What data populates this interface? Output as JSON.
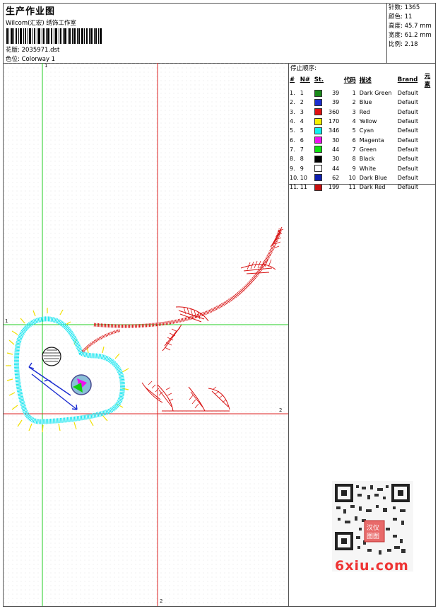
{
  "header": {
    "title": "生产作业图",
    "company": "Wilcom(汇宏) 绣饰工作室",
    "file_label": "花版",
    "file_value": "2035971.dst",
    "colorway_label": "色位",
    "colorway_value": "Colorway 1"
  },
  "stats": [
    {
      "label": "针数",
      "value": "1365"
    },
    {
      "label": "颜色",
      "value": "11"
    },
    {
      "label": "高度",
      "value": "45.7 mm"
    },
    {
      "label": "宽度",
      "value": "61.2 mm"
    },
    {
      "label": "比例",
      "value": "2.18"
    }
  ],
  "stop_sequence": {
    "title": "停止顺序:",
    "columns": [
      "#",
      "N#",
      "St.",
      "代码",
      "描述",
      "Brand",
      "元素"
    ],
    "rows": [
      {
        "n": "1.",
        "nn": "1",
        "color": "#1a8a1a",
        "st": "39",
        "code": "1",
        "desc": "Dark Green",
        "brand": "Default"
      },
      {
        "n": "2.",
        "nn": "2",
        "color": "#1c2fd0",
        "st": "39",
        "code": "2",
        "desc": "Blue",
        "brand": "Default"
      },
      {
        "n": "3.",
        "nn": "3",
        "color": "#e01010",
        "st": "360",
        "code": "3",
        "desc": "Red",
        "brand": "Default"
      },
      {
        "n": "4.",
        "nn": "4",
        "color": "#f4f000",
        "st": "170",
        "code": "4",
        "desc": "Yellow",
        "brand": "Default"
      },
      {
        "n": "5.",
        "nn": "5",
        "color": "#10f0f0",
        "st": "346",
        "code": "5",
        "desc": "Cyan",
        "brand": "Default"
      },
      {
        "n": "6.",
        "nn": "6",
        "color": "#f010f0",
        "st": "30",
        "code": "6",
        "desc": "Magenta",
        "brand": "Default"
      },
      {
        "n": "7.",
        "nn": "7",
        "color": "#10e010",
        "st": "44",
        "code": "7",
        "desc": "Green",
        "brand": "Default"
      },
      {
        "n": "8.",
        "nn": "8",
        "color": "#000000",
        "st": "30",
        "code": "8",
        "desc": "Black",
        "brand": "Default"
      },
      {
        "n": "9.",
        "nn": "9",
        "color": "#ffffff",
        "st": "44",
        "code": "9",
        "desc": "White",
        "brand": "Default"
      },
      {
        "n": "10.",
        "nn": "10",
        "color": "#1020b0",
        "st": "62",
        "code": "10",
        "desc": "Dark Blue",
        "brand": "Default"
      },
      {
        "n": "11.",
        "nn": "11",
        "color": "#c81010",
        "st": "199",
        "code": "11",
        "desc": "Dark Red",
        "brand": "Default"
      }
    ]
  },
  "guides": {
    "g1_top": "1",
    "g1_left": "1",
    "g2_right": "2",
    "g2_bottom": "2"
  },
  "watermark": {
    "site": "6xiu.com",
    "seal": "汉仪 图图"
  }
}
